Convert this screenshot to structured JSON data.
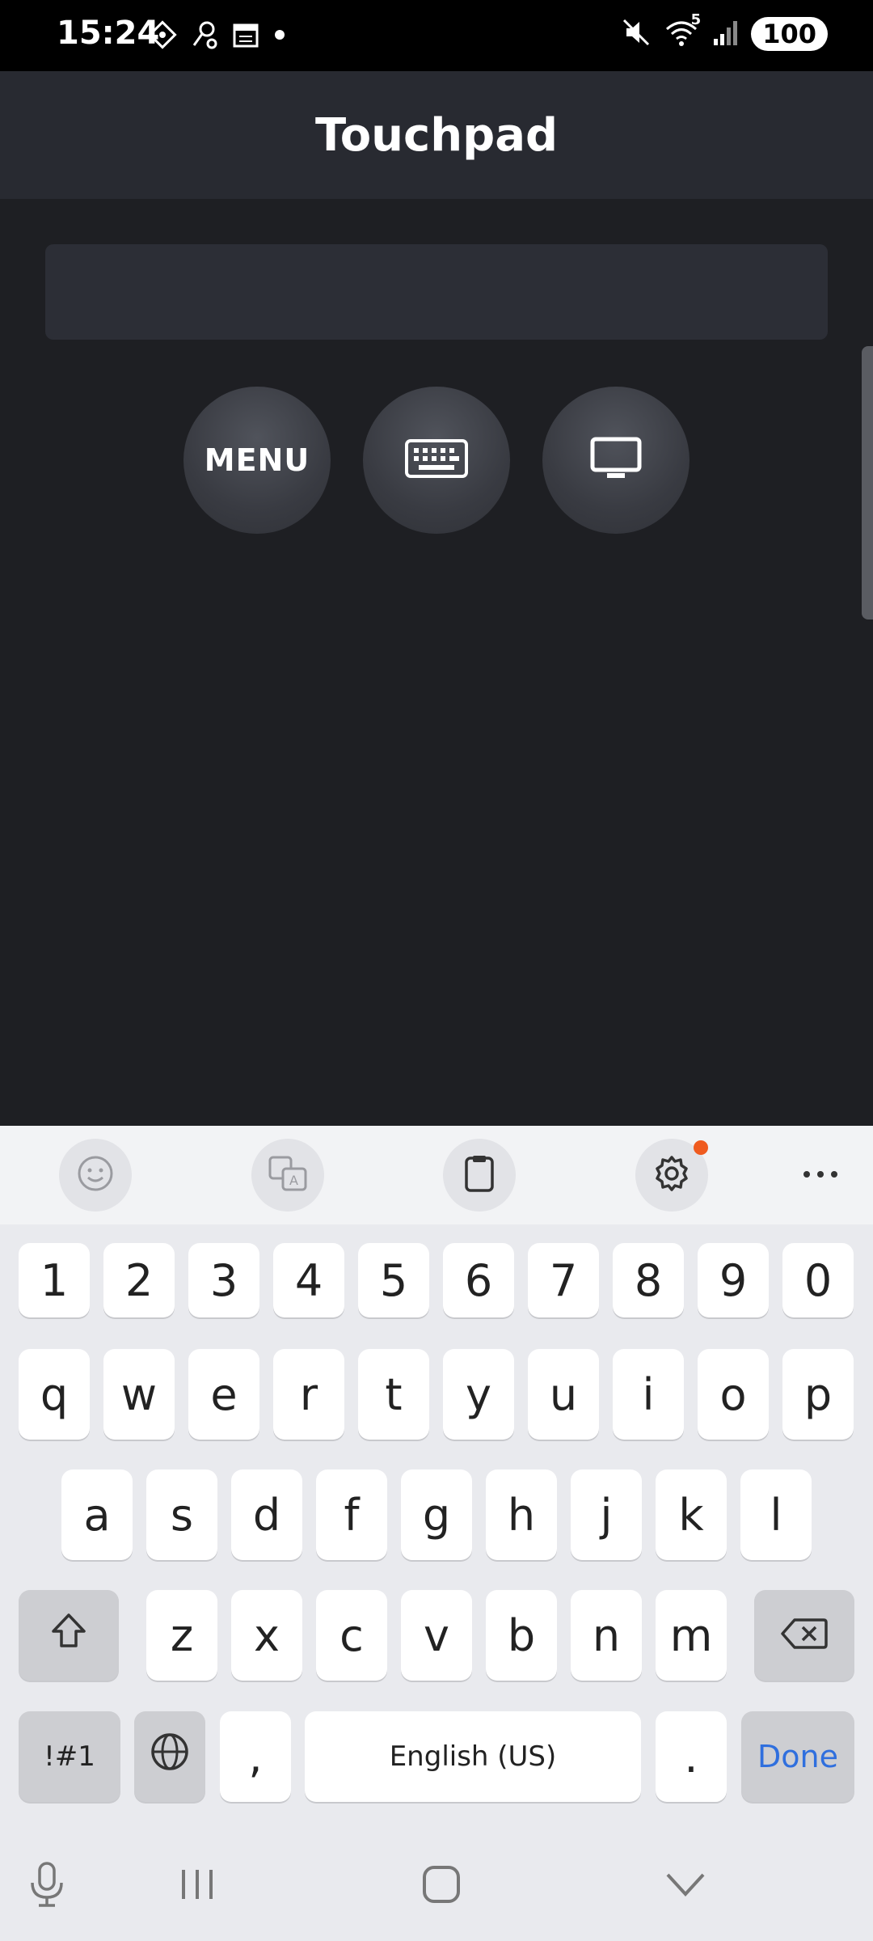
{
  "status_bar": {
    "time": "15:24",
    "left_icons": [
      "grid-icon",
      "key-icon",
      "calendar-icon",
      "dot-icon"
    ],
    "right_icons": [
      "mute-icon",
      "wifi-icon",
      "signal-icon"
    ],
    "wifi_label": "5",
    "battery": "100"
  },
  "header": {
    "title": "Touchpad"
  },
  "controls": {
    "menu_label": "MENU",
    "keyboard_icon": "keyboard-icon",
    "tv_icon": "tv-icon"
  },
  "keyboard": {
    "toolbar": [
      "emoji-icon",
      "translate-icon",
      "clipboard-icon",
      "settings-icon",
      "more-icon"
    ],
    "row_numbers": [
      "1",
      "2",
      "3",
      "4",
      "5",
      "6",
      "7",
      "8",
      "9",
      "0"
    ],
    "row1": [
      "q",
      "w",
      "e",
      "r",
      "t",
      "y",
      "u",
      "i",
      "o",
      "p"
    ],
    "row2": [
      "a",
      "s",
      "d",
      "f",
      "g",
      "h",
      "j",
      "k",
      "l"
    ],
    "row3": [
      "z",
      "x",
      "c",
      "v",
      "b",
      "n",
      "m"
    ],
    "symbols_label": "!#1",
    "comma": ",",
    "space_label": "English (US)",
    "period": ".",
    "done_label": "Done"
  },
  "colors": {
    "background": "#1e1f23",
    "header": "#282a31",
    "accent": "#2f6fde",
    "badge": "#ef5b1f"
  }
}
